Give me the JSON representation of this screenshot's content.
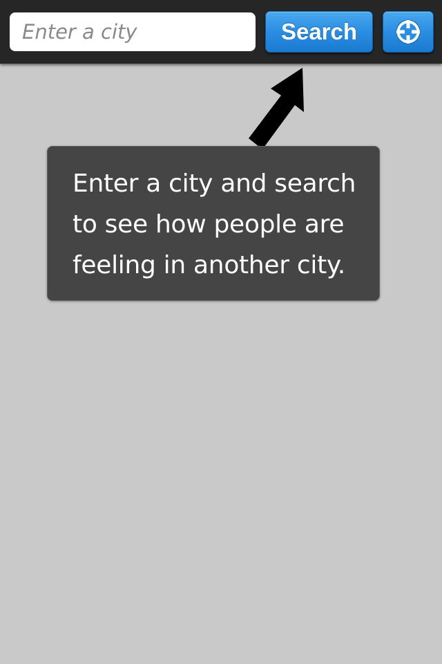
{
  "header": {
    "search": {
      "value": "",
      "placeholder": "Enter a city"
    },
    "search_button_label": "Search",
    "locate_button_icon": "crosshair-icon"
  },
  "hint": {
    "pointer_icon": "arrow-pointer-icon",
    "text": "Enter a city and search to see how people are feeling in another city."
  },
  "colors": {
    "background": "#c9c9c9",
    "topbar": "#262626",
    "accent": "#2a8ee3",
    "tooltip": "#454545"
  }
}
